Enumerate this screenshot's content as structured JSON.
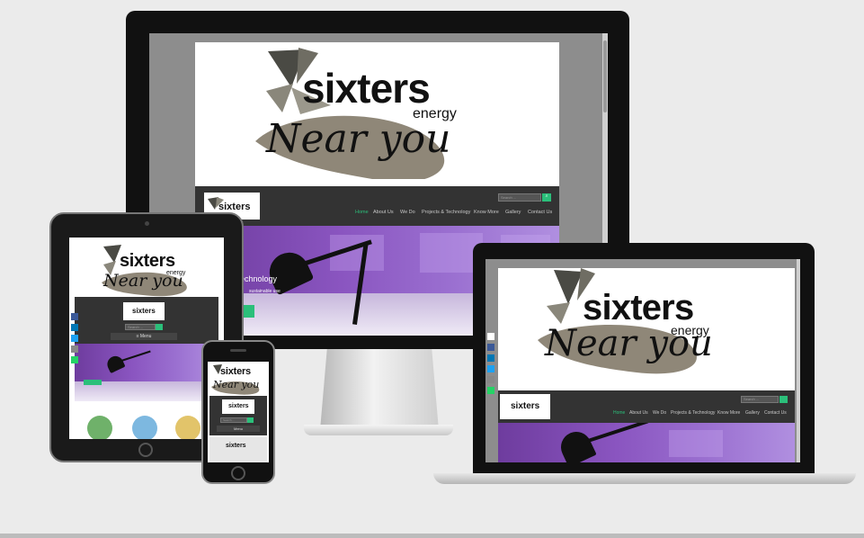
{
  "brand": {
    "word": "sixters",
    "sub": "energy",
    "tagline": "Near you"
  },
  "nav": {
    "items": [
      "Home",
      "About Us",
      "We Do",
      "Projects & Technology",
      "Know More",
      "Gallery",
      "Contact Us"
    ],
    "active": "Home"
  },
  "search": {
    "placeholder": "Search ..."
  },
  "hero": {
    "caption": "echnology",
    "subcaption": "sustainable use",
    "mobile_menu": "Menu"
  },
  "colors": {
    "accent": "#2bbf7a",
    "nav_bg": "#333333",
    "hero_purple": "#7b48b0"
  },
  "icons": [
    "share-icon",
    "facebook-icon",
    "linkedin-icon",
    "twitter-icon",
    "email-icon",
    "whatsapp-icon",
    "search-icon",
    "menu-icon"
  ]
}
